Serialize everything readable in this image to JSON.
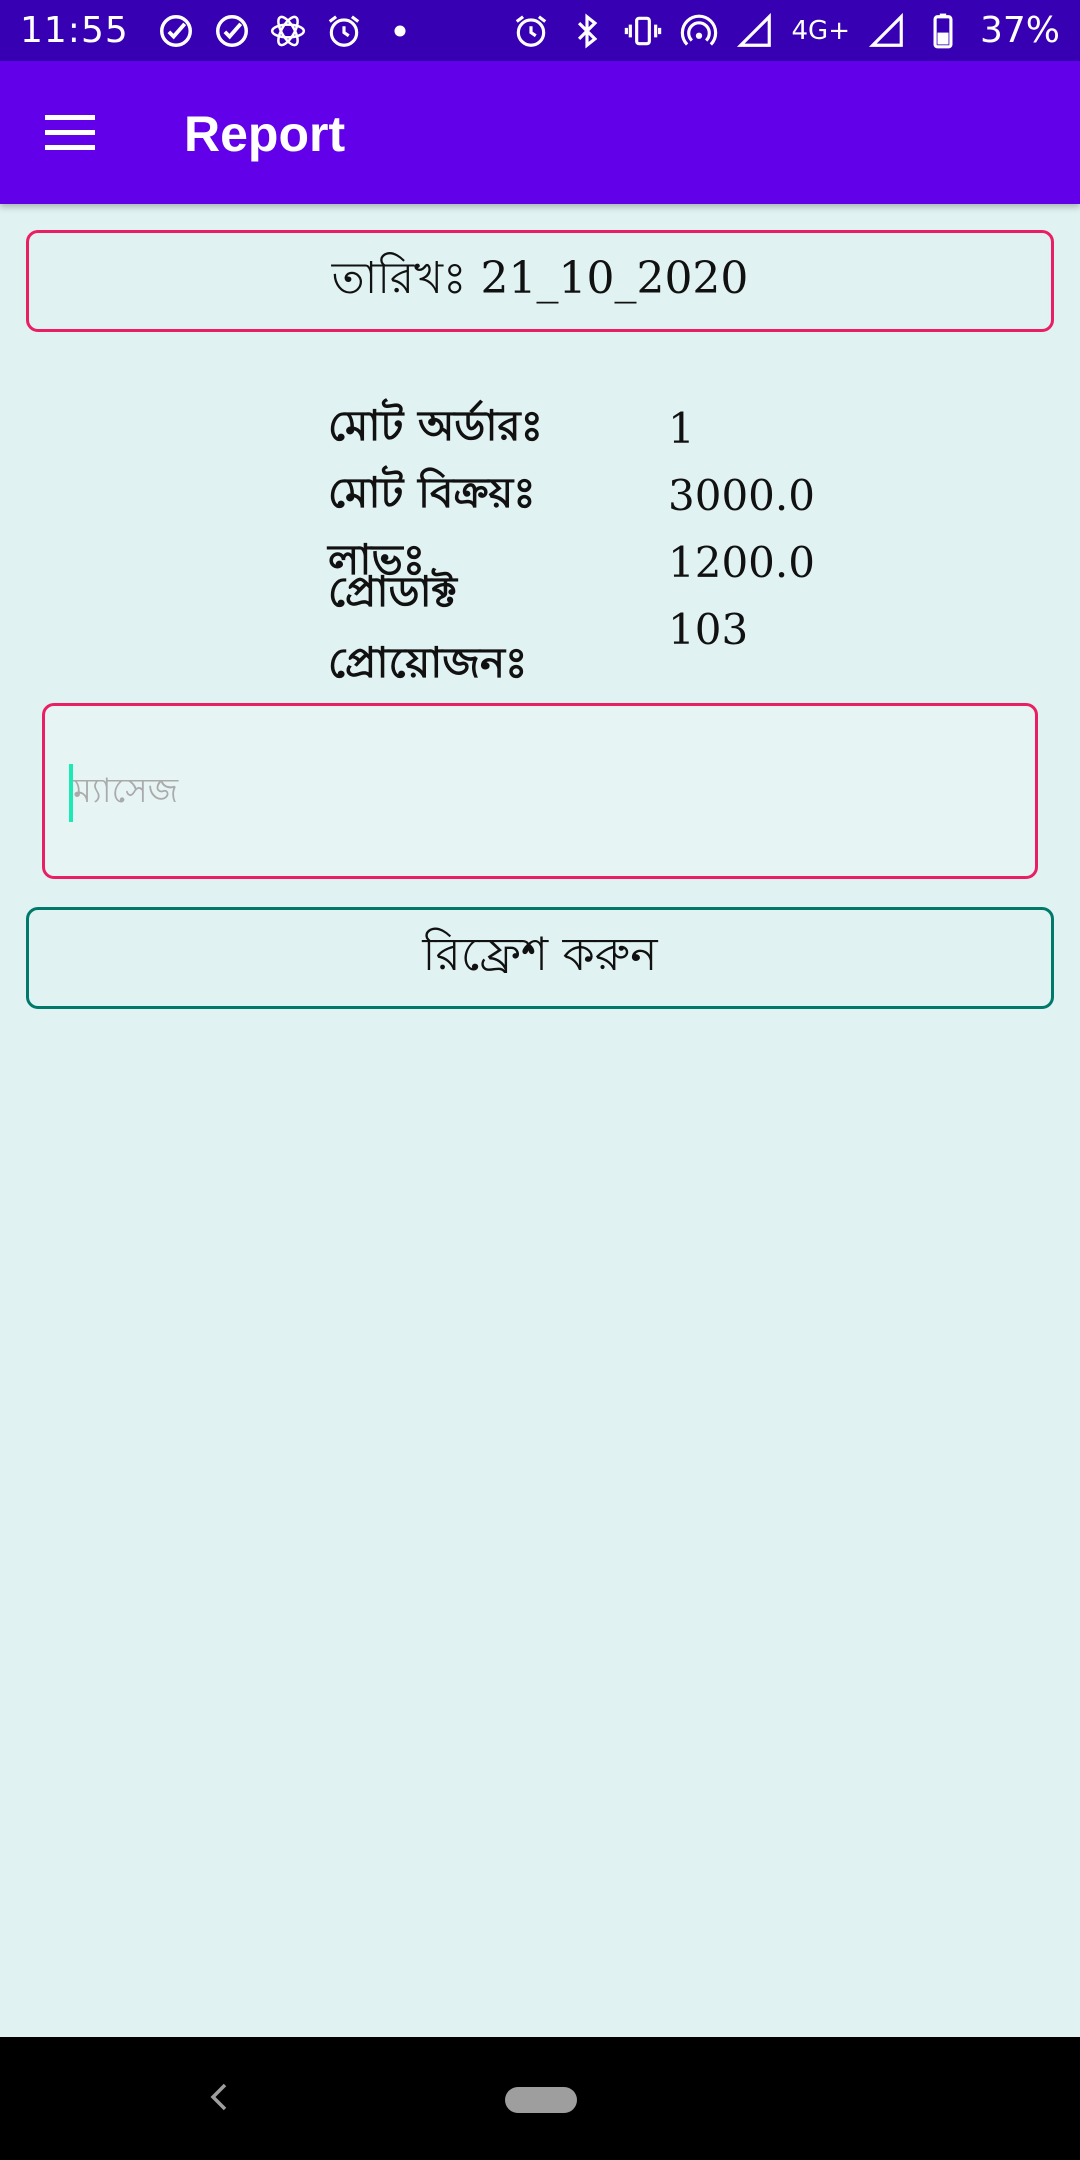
{
  "status_bar": {
    "time": "11:55",
    "network": "4G+",
    "battery": "37%",
    "left_icons": [
      "check-circle-icon",
      "check-circle-icon",
      "atom-icon",
      "alarm-icon",
      "dot-icon"
    ],
    "right_icons": [
      "alarm-icon",
      "bluetooth-icon",
      "vibrate-icon",
      "hotspot-icon",
      "signal-icon",
      "signal-icon",
      "battery-icon"
    ]
  },
  "app_bar": {
    "title": "Report",
    "menu_icon": "hamburger-menu-icon"
  },
  "date": {
    "text": "তারিখঃ 21_10_2020"
  },
  "stats": [
    {
      "label": "মোট অর্ডারঃ",
      "value": "1"
    },
    {
      "label": "মোট বিক্রয়ঃ",
      "value": "3000.0"
    },
    {
      "label": "লাভঃ",
      "value": "1200.0"
    },
    {
      "label": "প্রোডাক্ট প্রোয়োজনঃ",
      "value": "103"
    }
  ],
  "message": {
    "placeholder": "ম্যাসেজ",
    "value": ""
  },
  "refresh_button": {
    "label": "রিফ্রেশ করুন"
  },
  "colors": {
    "status_bar": "#3700b3",
    "app_bar": "#6200ea",
    "background": "#e0f2f1",
    "accent_border": "#e91e63",
    "button_border": "#00796b",
    "cursor": "#1de9b6"
  }
}
